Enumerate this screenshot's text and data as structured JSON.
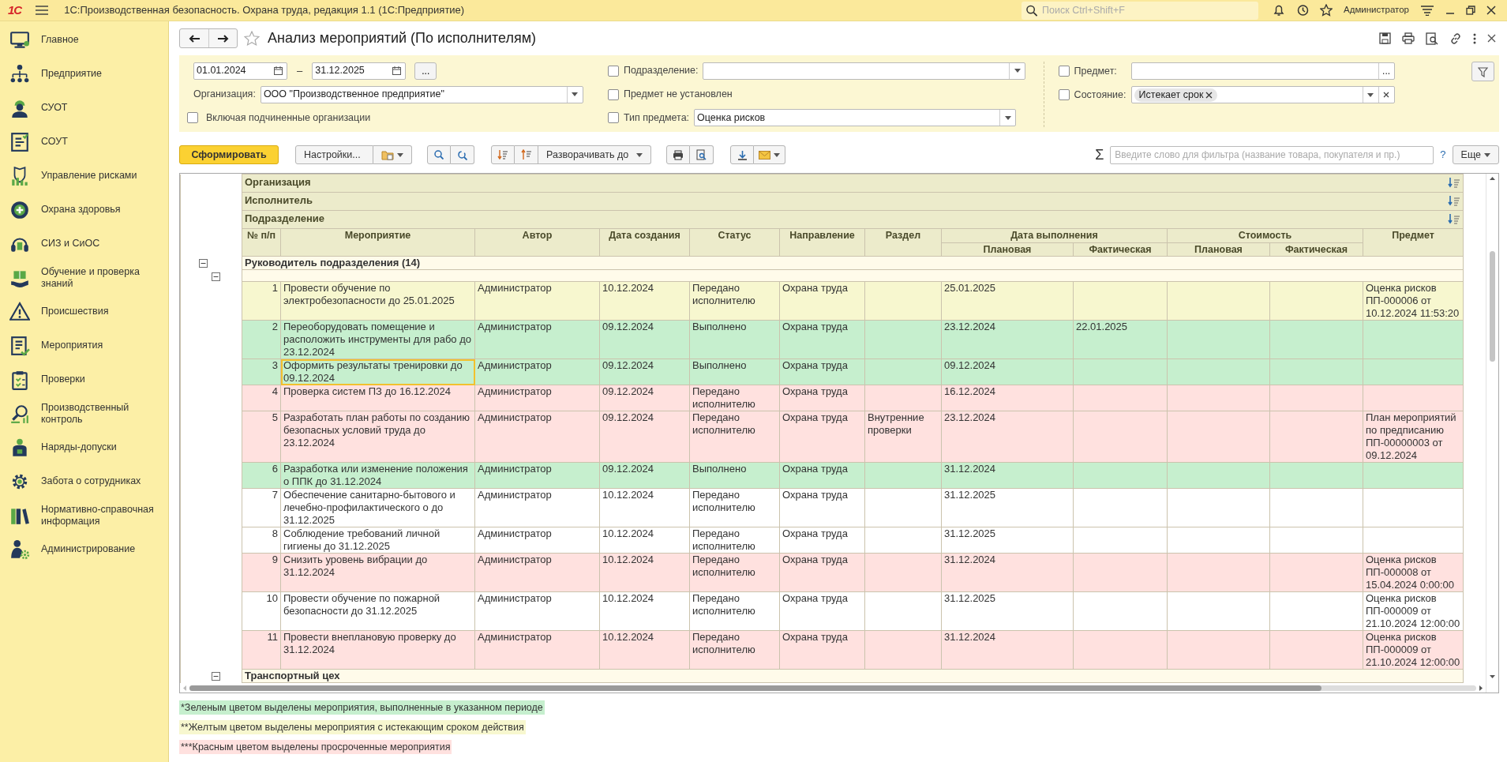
{
  "topbar": {
    "logo": "1С",
    "title": "1С:Производственная безопасность. Охрана труда, редакция 1.1 (1С:Предприятие)",
    "search_placeholder": "Поиск Ctrl+Shift+F",
    "user": "Администратор"
  },
  "sidebar": {
    "items": [
      {
        "label": "Главное"
      },
      {
        "label": "Предприятие"
      },
      {
        "label": "СУОТ"
      },
      {
        "label": "СОУТ"
      },
      {
        "label": "Управление рисками"
      },
      {
        "label": "Охрана здоровья"
      },
      {
        "label": "СИЗ и СиОС"
      },
      {
        "label": "Обучение и проверка знаний"
      },
      {
        "label": "Происшествия"
      },
      {
        "label": "Мероприятия"
      },
      {
        "label": "Проверки"
      },
      {
        "label": "Производственный контроль"
      },
      {
        "label": "Наряды-допуски"
      },
      {
        "label": "Забота о сотрудниках"
      },
      {
        "label": "Нормативно-справочная информация"
      },
      {
        "label": "Администрирование"
      }
    ]
  },
  "form": {
    "title": "Анализ мероприятий (По исполнителям)",
    "favorite": false
  },
  "filters": {
    "period": {
      "from": "01.01.2024",
      "separator": "–",
      "to": "31.12.2025",
      "more_button": "..."
    },
    "organization": {
      "label": "Организация:",
      "value": "ООО \"Производственное предприятие\""
    },
    "include_subsidiaries": {
      "label": "Включая подчиненные организации",
      "checked": false
    },
    "department": {
      "label": "Подразделение:",
      "checked": false
    },
    "subject_not_set": {
      "label": "Предмет не установлен",
      "checked": false
    },
    "subject_type": {
      "label": "Тип предмета:",
      "checked": false,
      "value": "Оценка рисков"
    },
    "subject": {
      "label": "Предмет:",
      "checked": false,
      "button": "..."
    },
    "state": {
      "label": "Состояние:",
      "checked": false,
      "tags": [
        "Истекает срок"
      ]
    }
  },
  "toolbar": {
    "generate": "Сформировать",
    "settings": "Настройки...",
    "expand_to": "Разворачивать до",
    "sum_symbol": "Σ",
    "filter_placeholder": "Введите слово для фильтра (название товара, покупателя и пр.)",
    "help": "?",
    "more": "Еще"
  },
  "table": {
    "grouping_rows": [
      {
        "label": "Организация"
      },
      {
        "label": "Исполнитель"
      },
      {
        "label": "Подразделение"
      }
    ],
    "columns": [
      {
        "label": "№ п/п"
      },
      {
        "label": "Мероприятие"
      },
      {
        "label": "Автор"
      },
      {
        "label": "Дата создания"
      },
      {
        "label": "Статус"
      },
      {
        "label": "Направление"
      },
      {
        "label": "Раздел"
      },
      {
        "label": "Дата выполнения",
        "subcolumns": [
          "Плановая",
          "Фактическая"
        ]
      },
      {
        "label": "Стоимость",
        "subcolumns": [
          "Плановая",
          "Фактическая"
        ]
      },
      {
        "label": "Предмет"
      }
    ],
    "groups": [
      {
        "label": "Руководитель подразделения (14)",
        "expanded": true,
        "children": [
          {
            "expanded": true,
            "rows": [
              {
                "number": "1",
                "activity": "Провести обучение по электробезопасности до 25.01.2025",
                "author": "Администратор",
                "created": "10.12.2024",
                "status": "Передано исполнителю",
                "direction": "Охрана труда",
                "planned_date": "25.01.2025",
                "subject": "Оценка рисков ПП-000006 от 10.12.2024 11:53:20",
                "color": "#f7f7cf",
                "selected": false
              },
              {
                "number": "2",
                "activity": "Переоборудовать помещение и расположить инструменты для рабо до 23.12.2024",
                "author": "Администратор",
                "created": "09.12.2024",
                "status": "Выполнено",
                "direction": "Охрана труда",
                "planned_date": "23.12.2024",
                "actual_date": "22.01.2025",
                "color": "#c6efce",
                "selected": false
              },
              {
                "number": "3",
                "activity": "Оформить результаты тренировки до 09.12.2024",
                "author": "Администратор",
                "created": "09.12.2024",
                "status": "Выполнено",
                "direction": "Охрана труда",
                "planned_date": "09.12.2024",
                "color": "#c6efce",
                "selected": true
              },
              {
                "number": "4",
                "activity": "Проверка систем ПЗ до 16.12.2024",
                "author": "Администратор",
                "created": "09.12.2024",
                "status": "Передано исполнителю",
                "direction": "Охрана труда",
                "planned_date": "16.12.2024",
                "color": "#ffe1df",
                "selected": false
              },
              {
                "number": "5",
                "activity": "Разработать план работы по созданию безопасных условий труда до 23.12.2024",
                "author": "Администратор",
                "created": "09.12.2024",
                "status": "Передано исполнителю",
                "direction": "Охрана труда",
                "section": "Внутренние проверки",
                "planned_date": "23.12.2024",
                "subject": "План мероприятий по предписанию ПП-00000003 от 09.12.2024",
                "color": "#ffe1df",
                "selected": false
              },
              {
                "number": "6",
                "activity": "Разработка или изменение положения о ППК до 31.12.2024",
                "author": "Администратор",
                "created": "09.12.2024",
                "status": "Выполнено",
                "direction": "Охрана труда",
                "planned_date": "31.12.2024",
                "color": "#c6efce",
                "selected": false
              },
              {
                "number": "7",
                "activity": "Обеспечение санитарно-бытового и лечебно-профилактического о до 31.12.2025",
                "author": "Администратор",
                "created": "10.12.2024",
                "status": "Передано исполнителю",
                "direction": "Охрана труда",
                "planned_date": "31.12.2025",
                "color": "#ffffff",
                "selected": false
              },
              {
                "number": "8",
                "activity": "Соблюдение требований личной гигиены до 31.12.2025",
                "author": "Администратор",
                "created": "10.12.2024",
                "status": "Передано исполнителю",
                "direction": "Охрана труда",
                "planned_date": "31.12.2025",
                "color": "#ffffff",
                "selected": false
              },
              {
                "number": "9",
                "activity": "Снизить уровень вибрации до 31.12.2024",
                "author": "Администратор",
                "created": "10.12.2024",
                "status": "Передано исполнителю",
                "direction": "Охрана труда",
                "planned_date": "31.12.2024",
                "subject": "Оценка рисков ПП-000008 от 15.04.2024 0:00:00",
                "color": "#ffe1df",
                "selected": false
              },
              {
                "number": "10",
                "activity": "Провести обучение по пожарной безопасности до 31.12.2025",
                "author": "Администратор",
                "created": "10.12.2024",
                "status": "Передано исполнителю",
                "direction": "Охрана труда",
                "planned_date": "31.12.2025",
                "subject": "Оценка рисков ПП-000009 от 21.10.2024 12:00:00",
                "color": "#ffffff",
                "selected": false
              },
              {
                "number": "11",
                "activity": "Провести внеплановую проверку до 31.12.2024",
                "author": "Администратор",
                "created": "10.12.2024",
                "status": "Передано исполнителю",
                "direction": "Охрана труда",
                "planned_date": "31.12.2024",
                "subject": "Оценка рисков ПП-000009 от 21.10.2024 12:00:00",
                "color": "#ffe1df",
                "selected": false
              }
            ]
          },
          {
            "label": "Транспортный цех",
            "expanded": true
          }
        ]
      }
    ]
  },
  "notes": [
    {
      "text": "*Зеленым цветом выделены мероприятия, выполненные в указанном периоде",
      "color": "#c6efce"
    },
    {
      "text": "**Желтым цветом выделены мероприятия с истекающим сроком действия",
      "color": "#f7f7cf"
    },
    {
      "text": "***Красным цветом выделены просроченные мероприятия",
      "color": "#ffe1df"
    }
  ]
}
